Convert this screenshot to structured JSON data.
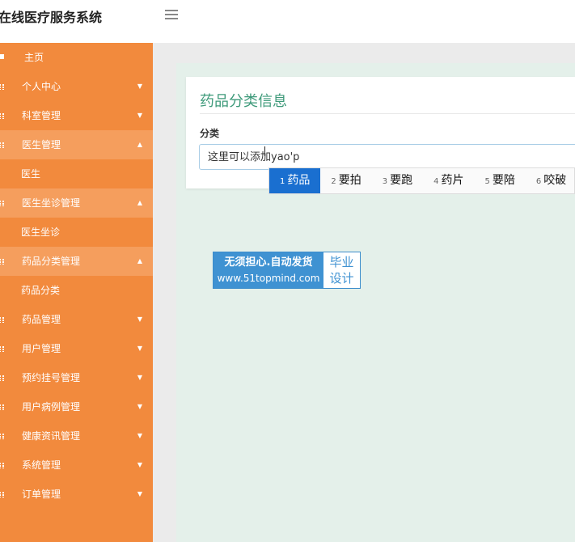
{
  "app": {
    "title": "在线医疗服务系统"
  },
  "sidebar": {
    "home": "主页",
    "items": [
      {
        "label": "个人中心",
        "open": false,
        "children": []
      },
      {
        "label": "科室管理",
        "open": false,
        "children": []
      },
      {
        "label": "医生管理",
        "open": true,
        "children": [
          "医生"
        ]
      },
      {
        "label": "医生坐诊管理",
        "open": true,
        "children": [
          "医生坐诊"
        ]
      },
      {
        "label": "药品分类管理",
        "open": true,
        "children": [
          "药品分类"
        ]
      },
      {
        "label": "药品管理",
        "open": false,
        "children": []
      },
      {
        "label": "用户管理",
        "open": false,
        "children": []
      },
      {
        "label": "预约挂号管理",
        "open": false,
        "children": []
      },
      {
        "label": "用户病例管理",
        "open": false,
        "children": []
      },
      {
        "label": "健康资讯管理",
        "open": false,
        "children": []
      },
      {
        "label": "系统管理",
        "open": false,
        "children": []
      },
      {
        "label": "订单管理",
        "open": false,
        "children": []
      }
    ],
    "chevron_down": "▼",
    "chevron_up": "▲"
  },
  "form": {
    "title": "药品分类信息",
    "field_label": "分类",
    "input_value": "这里可以添加yao'p"
  },
  "ime": {
    "candidates": [
      {
        "num": "1",
        "text": "药品"
      },
      {
        "num": "2",
        "text": "要拍"
      },
      {
        "num": "3",
        "text": "要跑"
      },
      {
        "num": "4",
        "text": "药片"
      },
      {
        "num": "5",
        "text": "要陪"
      },
      {
        "num": "6",
        "text": "咬破"
      }
    ],
    "selected_index": 0
  },
  "watermark": {
    "line1": "无须担心.自动发货",
    "line2": "www.51topmind.com",
    "right1": "毕业",
    "right2": "设计"
  },
  "colors": {
    "sidebar": "#f28a3d",
    "sidebar_open": "#f59e5d",
    "accent_title": "#3e9a7a",
    "ime_selected": "#1a6fd0",
    "watermark_blue": "#3f92d2"
  }
}
